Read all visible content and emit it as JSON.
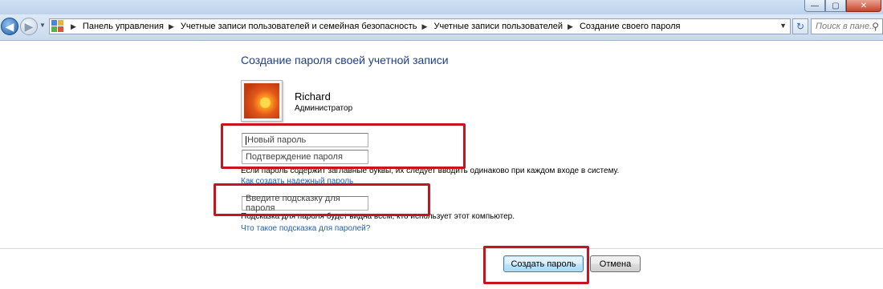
{
  "window": {
    "controls": {
      "minimize": "—",
      "maximize": "▢",
      "close": "✕"
    }
  },
  "nav": {
    "breadcrumb": [
      "Панель управления",
      "Учетные записи пользователей и семейная безопасность",
      "Учетные записи пользователей",
      "Создание своего пароля"
    ],
    "search_placeholder": "Поиск в пане...",
    "icons": {
      "back": "arrow-left-icon",
      "forward": "arrow-right-icon",
      "refresh": "refresh-icon",
      "search": "magnifier-icon"
    }
  },
  "main": {
    "heading": "Создание пароля своей учетной записи",
    "user": {
      "name": "Richard",
      "role": "Администратор"
    },
    "new_password_placeholder": "Новый пароль",
    "confirm_password_placeholder": "Подтверждение пароля",
    "case_note": "Если пароль содержит заглавные буквы, их следует вводить одинаково при каждом входе в систему.",
    "strong_password_link": "Как создать надежный пароль",
    "hint_placeholder": "Введите подсказку для пароля",
    "hint_note": "Подсказка для пароля будет видна всем, кто использует этот компьютер.",
    "hint_link": "Что такое подсказка для паролей?"
  },
  "buttons": {
    "create": "Создать пароль",
    "cancel": "Отмена"
  },
  "colors": {
    "heading": "#1e3f8c",
    "link": "#1f5fb4",
    "annotation": "#c8141e"
  }
}
